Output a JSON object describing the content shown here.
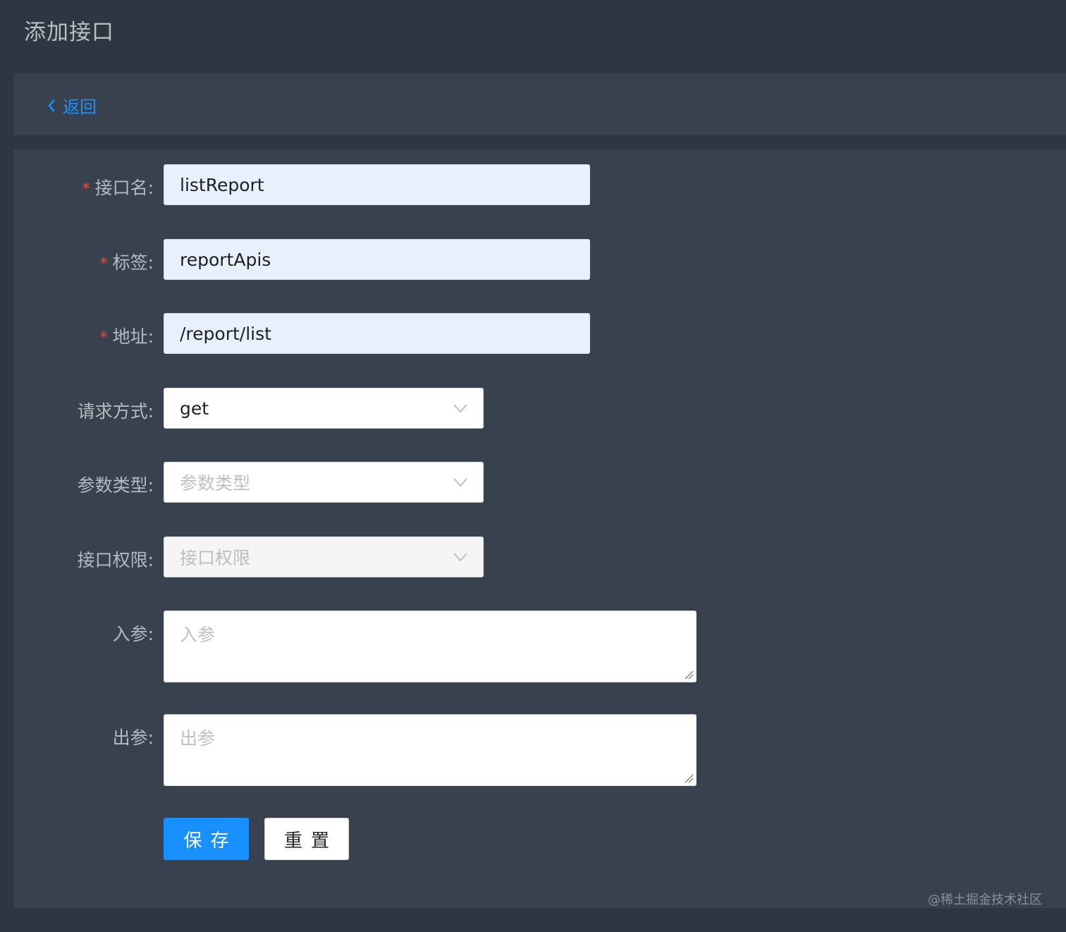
{
  "page": {
    "title": "添加接口"
  },
  "nav": {
    "back_label": "返回"
  },
  "form": {
    "fields": {
      "name": {
        "label": "接口名:",
        "required": true,
        "value": "listReport"
      },
      "tag": {
        "label": "标签:",
        "required": true,
        "value": "reportApis"
      },
      "address": {
        "label": "地址:",
        "required": true,
        "value": "/report/list"
      },
      "method": {
        "label": "请求方式:",
        "value": "get"
      },
      "param_type": {
        "label": "参数类型:",
        "placeholder": "参数类型"
      },
      "permission": {
        "label": "接口权限:",
        "placeholder": "接口权限",
        "disabled": true
      },
      "input_params": {
        "label": "入参:",
        "placeholder": "入参"
      },
      "output_params": {
        "label": "出参:",
        "placeholder": "出参"
      }
    },
    "required_mark": "*",
    "buttons": {
      "save": "保存",
      "reset": "重置"
    }
  },
  "watermark": "@稀土掘金技术社区",
  "colors": {
    "background": "#2f3642",
    "panel": "#38414d",
    "accent": "#1890ff",
    "required": "#f5483b",
    "autofill": "#e8f0fe"
  }
}
